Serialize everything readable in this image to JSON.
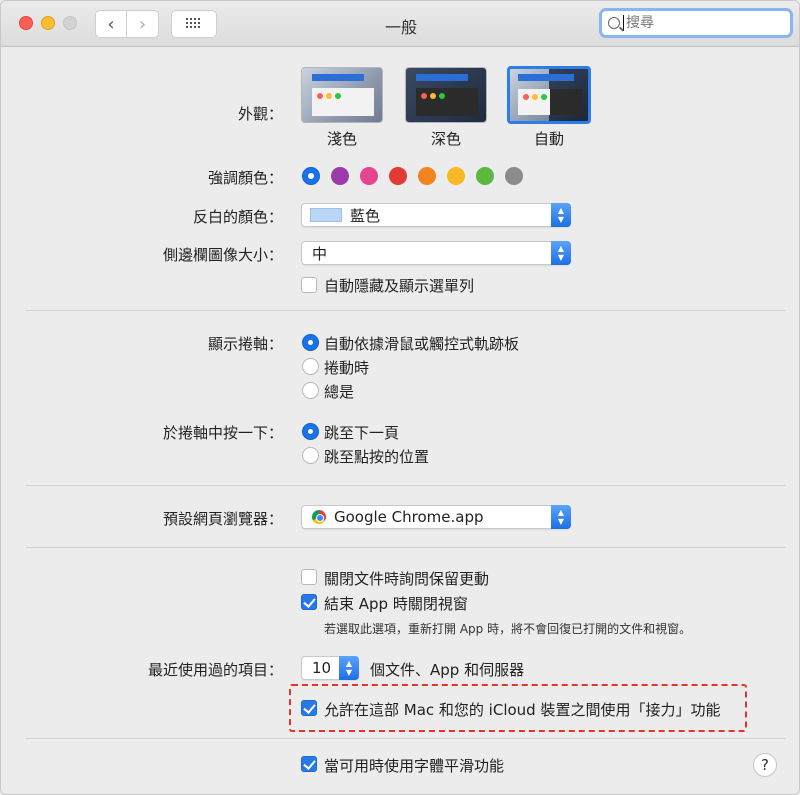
{
  "window": {
    "title": "一般"
  },
  "search": {
    "placeholder": "搜尋"
  },
  "appearance": {
    "label": "外觀：",
    "options": [
      "淺色",
      "深色",
      "自動"
    ],
    "selected": "自動"
  },
  "accent": {
    "label": "強調顏色：",
    "colors": [
      "#1a72e8",
      "#9b3aa8",
      "#e5458e",
      "#e23b35",
      "#f58220",
      "#f7b825",
      "#5cb83f",
      "#8c8c8c"
    ],
    "selected_index": 0
  },
  "highlight_color": {
    "label": "反白的顏色：",
    "value": "藍色",
    "chip": "#b9d6f7"
  },
  "sidebar_size": {
    "label": "側邊欄圖像大小：",
    "value": "中"
  },
  "menu_autohide": {
    "label": "自動隱藏及顯示選單列",
    "checked": false
  },
  "scrollbars": {
    "label": "顯示捲軸：",
    "options": [
      "自動依據滑鼠或觸控式軌跡板",
      "捲動時",
      "總是"
    ],
    "selected_index": 0
  },
  "click_scroll": {
    "label": "於捲軸中按一下：",
    "options": [
      "跳至下一頁",
      "跳至點按的位置"
    ],
    "selected_index": 0
  },
  "browser": {
    "label": "預設網頁瀏覽器：",
    "value": "Google Chrome.app"
  },
  "doc_options": {
    "ask_keep_changes": {
      "label": "關閉文件時詢問保留更動",
      "checked": false
    },
    "close_windows": {
      "label": "結束 App 時關閉視窗",
      "checked": true
    },
    "note": "若選取此選項，重新打開 App 時，將不會回復已打開的文件和視窗。"
  },
  "recent": {
    "label": "最近使用過的項目：",
    "value": "10",
    "suffix": "個文件、App 和伺服器"
  },
  "handoff": {
    "label": "允許在這部 Mac 和您的 iCloud 裝置之間使用「接力」功能",
    "checked": true
  },
  "font_smoothing": {
    "label": "當可用時使用字體平滑功能",
    "checked": true
  },
  "help": {
    "label": "?"
  }
}
